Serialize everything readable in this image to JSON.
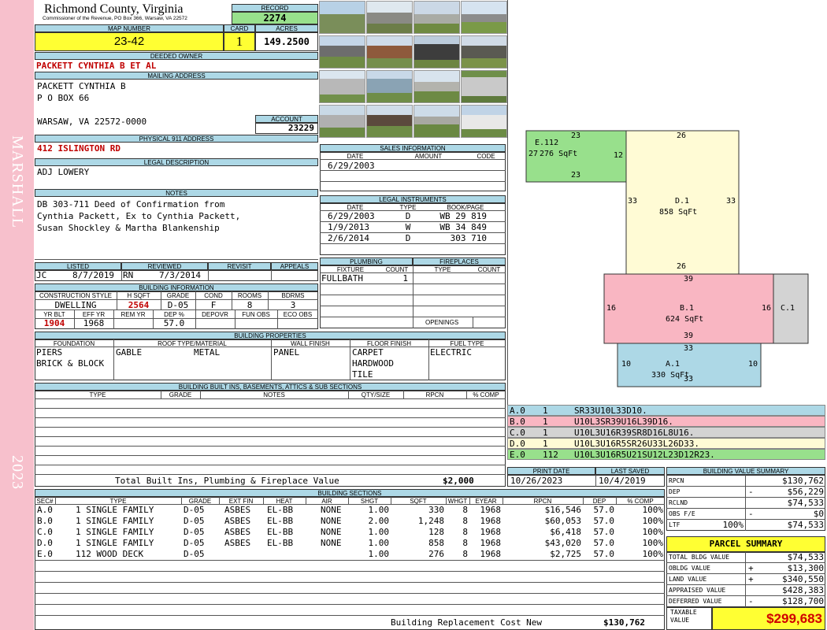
{
  "sidebar": {
    "district": "MARSHALL",
    "year": "2023"
  },
  "header": {
    "county": "Richmond County, Virginia",
    "commissioner": "Commissioner of the Revenue, PO Box 366, Warsaw, VA 22572",
    "record_label": "RECORD",
    "record": "2274"
  },
  "parcel": {
    "map_number_label": "MAP NUMBER",
    "map_number": "23-42",
    "card_label": "CARD",
    "card": "1",
    "acres_label": "ACRES",
    "acres": "149.2500"
  },
  "owner": {
    "deeded_label": "DEEDED OWNER",
    "deeded_owner": "PACKETT CYNTHIA B ET AL",
    "mailing_label": "MAILING ADDRESS",
    "mailing_lines": [
      "PACKETT CYNTHIA B",
      "P O BOX 66",
      "",
      "WARSAW, VA 22572-0000"
    ],
    "account_label": "ACCOUNT",
    "account": "23229",
    "physical_label": "PHYSICAL 911 ADDRESS",
    "physical_address": "412 ISLINGTON RD",
    "legal_label": "LEGAL DESCRIPTION",
    "legal": "ADJ LOWERY",
    "notes_label": "NOTES",
    "notes_lines": [
      "DB 303-711 Deed of Confirmation from",
      "Cynthia Packett, Ex to Cynthia Packett,",
      "Susan Shockley & Martha Blankenship"
    ]
  },
  "sales": {
    "title": "SALES INFORMATION",
    "cols": [
      "DATE",
      "AMOUNT",
      "CODE"
    ],
    "rows": [
      [
        "6/29/2003",
        "",
        ""
      ]
    ]
  },
  "legal_instruments": {
    "title": "LEGAL INSTRUMENTS",
    "cols": [
      "DATE",
      "TYPE",
      "BOOK/PAGE"
    ],
    "rows": [
      [
        "6/29/2003",
        "D",
        "WB 29 819"
      ],
      [
        "1/9/2013",
        "W",
        "WB 34 849"
      ],
      [
        "2/6/2014",
        "D",
        "303 710"
      ]
    ]
  },
  "review": {
    "listed_label": "LISTED",
    "reviewed_label": "REVIEWED",
    "revisit_label": "REVISIT",
    "appeals_label": "APPEALS",
    "listed_by": "JC",
    "listed_date": "8/7/2019",
    "reviewed_by": "RN",
    "reviewed_date": "7/3/2014"
  },
  "building_info": {
    "title": "BUILDING INFORMATION",
    "cols1": [
      "CONSTRUCTION STYLE",
      "H SQFT",
      "GRADE",
      "COND",
      "ROOMS",
      "BDRMS"
    ],
    "vals1": [
      "DWELLING",
      "2564",
      "D-05",
      "F",
      "8",
      "3"
    ],
    "cols2": [
      "YR BLT",
      "EFF YR",
      "REM YR",
      "DEP %",
      "DEPOVR",
      "FUN OBS",
      "ECO OBS"
    ],
    "vals2": [
      "1904",
      "1968",
      "",
      "57.0",
      "",
      "",
      ""
    ]
  },
  "plumbing": {
    "title": "PLUMBING",
    "cols": [
      "FIXTURE",
      "COUNT"
    ],
    "rows": [
      [
        "FULLBATH",
        "1"
      ]
    ]
  },
  "fireplaces": {
    "title": "FIREPLACES",
    "cols": [
      "TYPE",
      "COUNT"
    ],
    "openings_label": "OPENINGS"
  },
  "properties": {
    "title": "BUILDING PROPERTIES",
    "cols": [
      "FOUNDATION",
      "ROOF TYPE/MATERIAL",
      "WALL FINISH",
      "FLOOR FINISH",
      "FUEL TYPE"
    ],
    "foundation": [
      "PIERS",
      "BRICK & BLOCK"
    ],
    "roof_type": "GABLE",
    "roof_material": "METAL",
    "wall": "PANEL",
    "floor": [
      "CARPET",
      "HARDWOOD",
      "TILE"
    ],
    "fuel": "ELECTRIC"
  },
  "builtins": {
    "title": "BUILDING BUILT INS, BASEMENTS, ATTICS & SUB SECTIONS",
    "cols": [
      "TYPE",
      "GRADE",
      "NOTES",
      "QTY/SIZE",
      "RPCN",
      "% COMP"
    ],
    "total_label": "Total Built Ins, Plumbing & Fireplace Value",
    "total": "$2,000"
  },
  "print": {
    "print_label": "PRINT DATE",
    "saved_label": "LAST SAVED",
    "print_date": "10/26/2023",
    "last_saved": "10/4/2019"
  },
  "sketch": {
    "areas": [
      {
        "code": "E.112",
        "area": "276 SqFt",
        "color": "#98e08c"
      },
      {
        "code": "D.1",
        "area": "858 SqFt",
        "color": "#fffbd5"
      },
      {
        "code": "B.1",
        "area": "624 SqFt",
        "color": "#f9b6c2"
      },
      {
        "code": "C.1",
        "area": "",
        "color": "#d3d3d3"
      },
      {
        "code": "A.1",
        "area": "330 SqFt",
        "color": "#add8e6"
      }
    ],
    "dims": [
      "23",
      "23",
      "12",
      "27",
      "26",
      "33",
      "33",
      "26",
      "39",
      "39",
      "16",
      "16",
      "33",
      "33",
      "10",
      "10"
    ],
    "legend": [
      {
        "sec": "A.0",
        "n": "1",
        "path": "SR33U10L33D10.",
        "color": "#add8e6"
      },
      {
        "sec": "B.0",
        "n": "1",
        "path": "U10L3SR39U16L39D16.",
        "color": "#f9b6c2"
      },
      {
        "sec": "C.0",
        "n": "1",
        "path": "U10L3U16R39SR8D16L8U16.",
        "color": "#d3d3d3"
      },
      {
        "sec": "D.0",
        "n": "1",
        "path": "U10L3U16R5SR26U33L26D33.",
        "color": "#fffbd5"
      },
      {
        "sec": "E.0",
        "n": "112",
        "path": "U10L3U16R5U21SU12L23D12R23.",
        "color": "#98e08c"
      }
    ]
  },
  "sections": {
    "title": "BUILDING SECTIONS",
    "cols": [
      "SEC#",
      "TYPE",
      "GRADE",
      "EXT FIN",
      "HEAT",
      "AIR",
      "SHGT",
      "SQFT",
      "WHGT",
      "EYEAR",
      "RPCN",
      "DEP",
      "% COMP"
    ],
    "rows": [
      [
        "A.0",
        "1 SINGLE FAMILY",
        "D-05",
        "ASBES",
        "EL-BB",
        "NONE",
        "1.00",
        "330",
        "8",
        "1968",
        "$16,546",
        "57.0",
        "100%"
      ],
      [
        "B.0",
        "1 SINGLE FAMILY",
        "D-05",
        "ASBES",
        "EL-BB",
        "NONE",
        "2.00",
        "1,248",
        "8",
        "1968",
        "$60,053",
        "57.0",
        "100%"
      ],
      [
        "C.0",
        "1 SINGLE FAMILY",
        "D-05",
        "ASBES",
        "EL-BB",
        "NONE",
        "1.00",
        "128",
        "8",
        "1968",
        "$6,418",
        "57.0",
        "100%"
      ],
      [
        "D.0",
        "1 SINGLE FAMILY",
        "D-05",
        "ASBES",
        "EL-BB",
        "NONE",
        "1.00",
        "858",
        "8",
        "1968",
        "$43,020",
        "57.0",
        "100%"
      ],
      [
        "E.0",
        "112 WOOD DECK",
        "D-05",
        "",
        "",
        "",
        "1.00",
        "276",
        "8",
        "1968",
        "$2,725",
        "57.0",
        "100%"
      ]
    ],
    "replacement_label": "Building Replacement Cost New",
    "replacement": "$130,762"
  },
  "bvs": {
    "title": "BUILDING VALUE SUMMARY",
    "rows": [
      {
        "label": "RPCN",
        "sign": "",
        "pct": "",
        "value": "$130,762"
      },
      {
        "label": "DEP",
        "sign": "-",
        "pct": "",
        "value": "$56,229"
      },
      {
        "label": "RCLND",
        "sign": "",
        "pct": "",
        "value": "$74,533"
      },
      {
        "label": "OBS F/E",
        "sign": "-",
        "pct": "",
        "value": "$0"
      },
      {
        "label": "LTF",
        "sign": "",
        "pct": "100%",
        "value": "$74,533"
      }
    ]
  },
  "summary": {
    "title": "PARCEL SUMMARY",
    "rows": [
      {
        "label": "TOTAL BLDG VALUE",
        "sign": "",
        "value": "$74,533"
      },
      {
        "label": "OBLDG VALUE",
        "sign": "+",
        "value": "$13,300"
      },
      {
        "label": "LAND VALUE",
        "sign": "+",
        "value": "$340,550"
      },
      {
        "label": "APPRAISED VALUE",
        "sign": "",
        "value": "$428,383"
      },
      {
        "label": "DEFERRED VALUE",
        "sign": "-",
        "value": "$128,700"
      }
    ],
    "taxable_label": "TAXABLE VALUE",
    "taxable": "$299,683"
  },
  "photos": [
    "barn photo",
    "shed photo",
    "field photo",
    "outbuilding photo",
    "pole barn photo",
    "house photo",
    "barn interior photo",
    "shed photo",
    "garage photo",
    "metal building photo",
    "tractor shed photo",
    "shed photo",
    "barn photo",
    "outbuilding photo",
    "house photo",
    "dwelling photo"
  ]
}
